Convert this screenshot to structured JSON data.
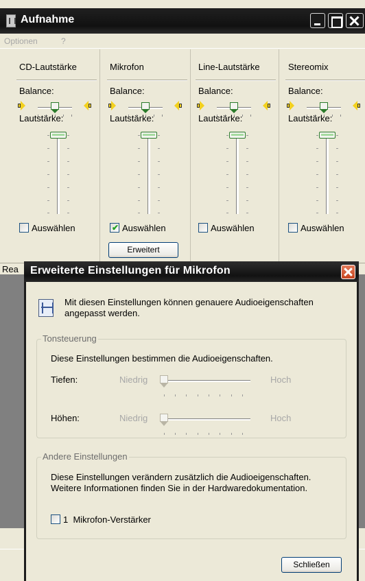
{
  "main_window": {
    "title": "Aufnahme",
    "menu": [
      "Optionen",
      "?"
    ],
    "channels": [
      {
        "name": "CD-Lautstärke",
        "balance_label": "Balance:",
        "volume_label": "Lautstärke:",
        "select_label": "Auswählen",
        "selected": false
      },
      {
        "name": "Mikrofon",
        "balance_label": "Balance:",
        "volume_label": "Lautstärke:",
        "select_label": "Auswählen",
        "selected": true,
        "advanced_label": "Erweitert"
      },
      {
        "name": "Line-Lautstärke",
        "balance_label": "Balance:",
        "volume_label": "Lautstärke:",
        "select_label": "Auswählen",
        "selected": false
      },
      {
        "name": "Stereomix",
        "balance_label": "Balance:",
        "volume_label": "Lautstärke:",
        "select_label": "Auswählen",
        "selected": false
      }
    ],
    "status_text": "Rea"
  },
  "dialog": {
    "title": "Erweiterte Einstellungen für Mikrofon",
    "description": "Mit diesen Einstellungen können genauere Audioeigenschaften angepasst werden.",
    "tone_group": {
      "legend": "Tonsteuerung",
      "text": "Diese Einstellungen bestimmen die Audioeigenschaften.",
      "bass_label": "Tiefen:",
      "treble_label": "Höhen:",
      "low_label": "Niedrig",
      "high_label": "Hoch"
    },
    "other_group": {
      "legend": "Andere Einstellungen",
      "text_line1": "Diese Einstellungen verändern zusätzlich die Audioeigenschaften.",
      "text_line2": "Weitere Informationen finden Sie in der Hardwaredokumentation.",
      "checkbox_label": "1  Mikrofon-Verstärker",
      "checkbox_checked": false
    },
    "close_label": "Schließen"
  },
  "colors": {
    "titlebar": "#111111",
    "window_bg": "#ece9d8",
    "dialog_close": "#c7451f",
    "checkmark": "#21a121"
  }
}
